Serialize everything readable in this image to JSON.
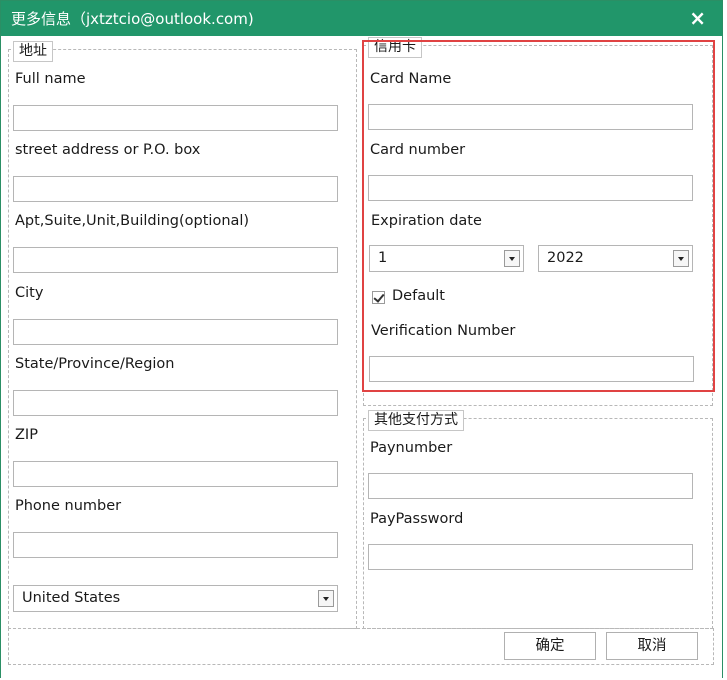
{
  "window": {
    "title": "更多信息（jxtztcio@outlook.com)",
    "close_glyph": "×"
  },
  "address": {
    "legend": "地址",
    "full_name_label": "Full name",
    "full_name_value": "",
    "street_label": "street address or P.O. box",
    "street_value": "",
    "apt_label": "Apt,Suite,Unit,Building(optional)",
    "apt_value": "",
    "city_label": "City",
    "city_value": "",
    "state_label": "State/Province/Region",
    "state_value": "",
    "zip_label": "ZIP",
    "zip_value": "",
    "phone_label": "Phone number",
    "phone_value": "",
    "country_selected": "United States"
  },
  "credit_card": {
    "legend": "信用卡",
    "card_name_label": "Card Name",
    "card_name_value": "",
    "card_number_label": "Card number",
    "card_number_value": "",
    "expiration_label": "Expiration date",
    "month_selected": "1",
    "year_selected": "2022",
    "default_label": "Default",
    "default_checked": true,
    "verification_label": "Verification Number",
    "verification_value": ""
  },
  "other_payment": {
    "legend": "其他支付方式",
    "paynumber_label": "Paynumber",
    "paynumber_value": "",
    "paypassword_label": "PayPassword",
    "paypassword_value": ""
  },
  "footer": {
    "ok_label": "确定",
    "cancel_label": "取消"
  },
  "colors": {
    "titlebar": "#21966a",
    "highlight_frame": "#e04343"
  }
}
